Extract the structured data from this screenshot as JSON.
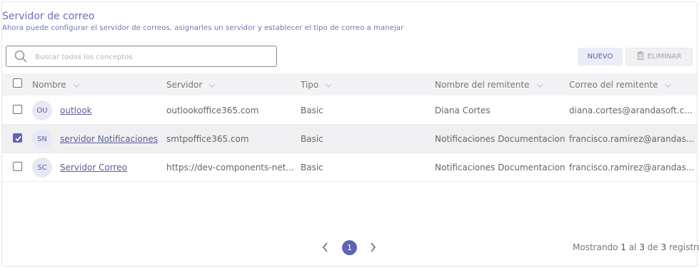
{
  "header": {
    "title": "Servidor de correo",
    "subtitle": "Ahora puede configurar el servidor de correos, asignarles un servidor y establecer el tipo de correo a manejar"
  },
  "search": {
    "placeholder": "Buscar todos los conceptos"
  },
  "toolbar": {
    "new_label": "NUEVO",
    "delete_label": "ELIMINAR"
  },
  "table": {
    "columns": [
      "Nombre",
      "Servidor",
      "Tipo",
      "Nombre del remitente",
      "Correo del remitente"
    ],
    "rows": [
      {
        "checked": false,
        "initials": "OU",
        "name": "outlook",
        "server": "outlookoffice365.com",
        "type": "Basic",
        "sender_name": "Diana Cortes",
        "sender_email": "diana.cortes@arandasoft.c..."
      },
      {
        "checked": true,
        "initials": "SN",
        "name": "servidor Notificaciones",
        "server": "smtpoffice365.com",
        "type": "Basic",
        "sender_name": "Notificaciones Documentacion",
        "sender_email": "francisco.ramirez@arandas..."
      },
      {
        "checked": false,
        "initials": "SC",
        "name": "Servidor Correo",
        "server": "https://dev-components-net...",
        "type": "Basic",
        "sender_name": "Notificaciones Documentacion",
        "sender_email": "francisco.ramirez@arandas..."
      }
    ]
  },
  "pagination": {
    "current_page": "1",
    "records_prefix": "Mostrando",
    "from": "1",
    "al": "al",
    "to": "3",
    "de": "de",
    "total": "3",
    "records_suffix": "registros"
  },
  "colors": {
    "accent": "#6064b5",
    "title": "#6b6fb8"
  }
}
